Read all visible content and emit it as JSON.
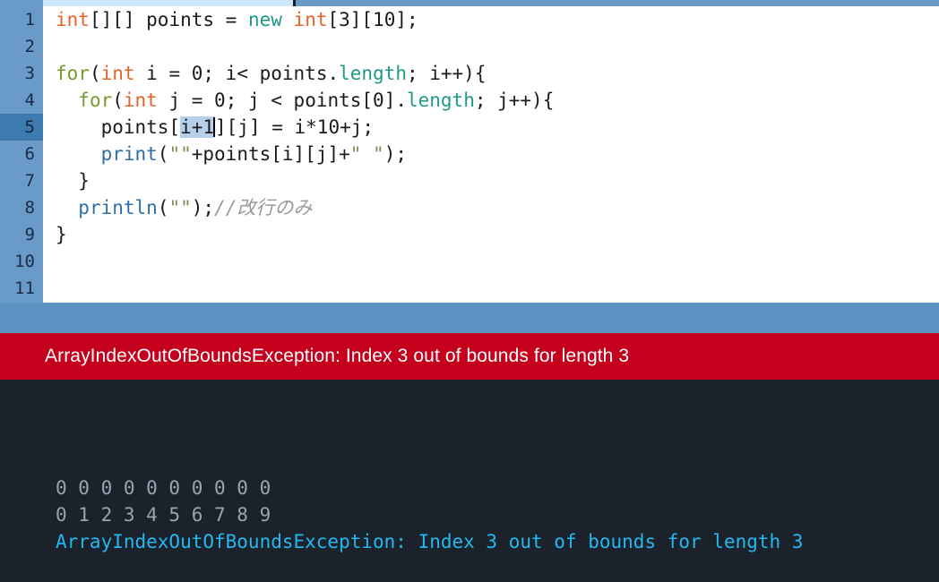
{
  "app": {
    "kind": "code-editor-with-console"
  },
  "colors": {
    "gutter_bg": "#6a9bc8",
    "gutter_active_bg": "#3c7ab0",
    "editor_bg": "#ffffff",
    "band_bg": "#5d93c2",
    "error_bar_bg": "#c4001d",
    "error_bar_fg": "#ffffff",
    "console_bg": "#1b222b",
    "console_out_fg": "#9aa4b0",
    "console_err_fg": "#21b9ef",
    "tab_strip_bg": "#cde8fb",
    "selection_bg": "#b6d0ec",
    "type_token": "#e8622a",
    "keyword_token": "#1f9b85",
    "control_token": "#7a9a2e",
    "function_token": "#2f6fa8",
    "string_token": "#7d8d52",
    "comment_token": "#999999"
  },
  "editor": {
    "active_line": 5,
    "gutter_numbers": [
      "1",
      "2",
      "3",
      "4",
      "5",
      "6",
      "7",
      "8",
      "9",
      "10",
      "11"
    ],
    "selection_text": "i+1",
    "lines": [
      {
        "number": "1",
        "tokens": [
          {
            "t": "int",
            "c": "type"
          },
          {
            "t": "[][] points = ",
            "c": "plain"
          },
          {
            "t": "new",
            "c": "kw"
          },
          {
            "t": " ",
            "c": "plain"
          },
          {
            "t": "int",
            "c": "type"
          },
          {
            "t": "[3][10];",
            "c": "plain"
          }
        ]
      },
      {
        "number": "2",
        "tokens": []
      },
      {
        "number": "3",
        "tokens": [
          {
            "t": "for",
            "c": "ctrl"
          },
          {
            "t": "(",
            "c": "plain"
          },
          {
            "t": "int",
            "c": "type"
          },
          {
            "t": " i = 0; i< points.",
            "c": "plain"
          },
          {
            "t": "length",
            "c": "field"
          },
          {
            "t": "; i++){",
            "c": "plain"
          }
        ]
      },
      {
        "number": "4",
        "tokens": [
          {
            "t": "  ",
            "c": "plain"
          },
          {
            "t": "for",
            "c": "ctrl"
          },
          {
            "t": "(",
            "c": "plain"
          },
          {
            "t": "int",
            "c": "type"
          },
          {
            "t": " j = 0; j < points[0].",
            "c": "plain"
          },
          {
            "t": "length",
            "c": "field"
          },
          {
            "t": "; j++){",
            "c": "plain"
          }
        ]
      },
      {
        "number": "5",
        "tokens": [
          {
            "t": "    points[",
            "c": "plain"
          },
          {
            "t": "i+1",
            "c": "selected"
          },
          {
            "t": "][j] = i*10+j;",
            "c": "plain"
          }
        ]
      },
      {
        "number": "6",
        "tokens": [
          {
            "t": "    ",
            "c": "plain"
          },
          {
            "t": "print",
            "c": "fn"
          },
          {
            "t": "(",
            "c": "plain"
          },
          {
            "t": "\"\"",
            "c": "str"
          },
          {
            "t": "+points[i][j]+",
            "c": "plain"
          },
          {
            "t": "\" \"",
            "c": "str"
          },
          {
            "t": ");",
            "c": "plain"
          }
        ]
      },
      {
        "number": "7",
        "tokens": [
          {
            "t": "  }",
            "c": "plain"
          }
        ]
      },
      {
        "number": "8",
        "tokens": [
          {
            "t": "  ",
            "c": "plain"
          },
          {
            "t": "println",
            "c": "fn"
          },
          {
            "t": "(",
            "c": "plain"
          },
          {
            "t": "\"\"",
            "c": "str"
          },
          {
            "t": ");",
            "c": "plain"
          },
          {
            "t": "//改行のみ",
            "c": "cmt"
          }
        ]
      },
      {
        "number": "9",
        "tokens": [
          {
            "t": "}",
            "c": "plain"
          }
        ]
      },
      {
        "number": "10",
        "tokens": []
      },
      {
        "number": "11",
        "tokens": []
      }
    ]
  },
  "error_banner": {
    "message": "ArrayIndexOutOfBoundsException: Index 3 out of bounds for length 3"
  },
  "console": {
    "lines": [
      {
        "text": "0 0 0 0 0 0 0 0 0 0",
        "kind": "out"
      },
      {
        "text": "0 1 2 3 4 5 6 7 8 9",
        "kind": "out"
      },
      {
        "text": "ArrayIndexOutOfBoundsException: Index 3 out of bounds for length 3",
        "kind": "err"
      }
    ]
  }
}
